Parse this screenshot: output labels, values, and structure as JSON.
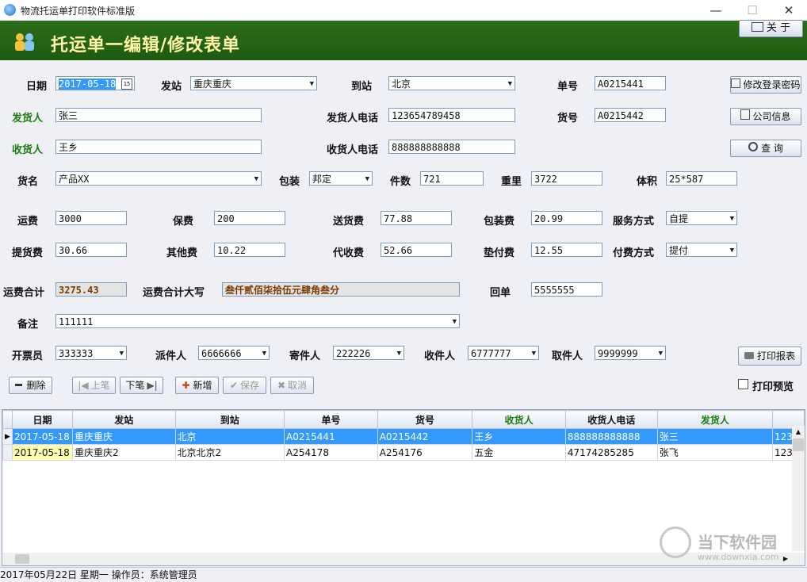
{
  "window": {
    "title": "物流托运单打印软件标准版",
    "min": "—",
    "max": "☐",
    "close": "✕"
  },
  "header": {
    "title": "托运单一编辑/修改表单",
    "about": "关 于"
  },
  "side_buttons": {
    "change_password": "修改登录密码",
    "company_info": "公司信息",
    "query": "查 询",
    "print_report": "打印报表"
  },
  "form": {
    "date_label": "日期",
    "date_value": "2017-05-18",
    "from_station_label": "发站",
    "from_station_value": "重庆重庆",
    "to_station_label": "到站",
    "to_station_value": "北京",
    "order_no_label": "单号",
    "order_no_value": "A0215441",
    "shipper_label": "发货人",
    "shipper_value": "张三",
    "shipper_phone_label": "发货人电话",
    "shipper_phone_value": "123654789458",
    "goods_no_label": "货号",
    "goods_no_value": "A0215442",
    "consignee_label": "收货人",
    "consignee_value": "王乡",
    "consignee_phone_label": "收货人电话",
    "consignee_phone_value": "888888888888",
    "goods_name_label": "货名",
    "goods_name_value": "产品XX",
    "packing_label": "包装",
    "packing_value": "邦定",
    "pieces_label": "件数",
    "pieces_value": "721",
    "weight_label": "重里",
    "weight_value": "3722",
    "volume_label": "体积",
    "volume_value": "25*587",
    "freight_label": "运费",
    "freight_value": "3000",
    "insurance_label": "保费",
    "insurance_value": "200",
    "delivery_fee_label": "送货费",
    "delivery_fee_value": "77.88",
    "packing_fee_label": "包装费",
    "packing_fee_value": "20.99",
    "service_label": "服务方式",
    "service_value": "自提",
    "pickup_fee_label": "提货费",
    "pickup_fee_value": "30.66",
    "other_fee_label": "其他费",
    "other_fee_value": "10.22",
    "collect_fee_label": "代收费",
    "collect_fee_value": "52.66",
    "advance_fee_label": "垫付费",
    "advance_fee_value": "12.55",
    "payment_label": "付费方式",
    "payment_value": "提付",
    "total_label": "运费合计",
    "total_value": "3275.43",
    "total_upper_label": "运费合计大写",
    "total_upper_value": "叁仟贰佰柒拾伍元肆角叁分",
    "receipt_label": "回单",
    "receipt_value": "5555555",
    "remark_label": "备注",
    "remark_value": "111111",
    "issuer_label": "开票员",
    "issuer_value": "333333",
    "dispatcher_label": "派件人",
    "dispatcher_value": "6666666",
    "sender_label": "寄件人",
    "sender_value": "222226",
    "receiver_label": "收件人",
    "receiver_value": "6777777",
    "collector_label": "取件人",
    "collector_value": "9999999"
  },
  "actions": {
    "delete": "删除",
    "prev": "上笔",
    "next": "下笔",
    "add": "新增",
    "save": "保存",
    "cancel": "取消",
    "print_preview": "打印预览"
  },
  "grid": {
    "columns": [
      "日期",
      "发站",
      "到站",
      "单号",
      "货号",
      "收货人",
      "收货人电话",
      "发货人",
      ""
    ],
    "rows": [
      [
        "2017-05-18",
        "重庆重庆",
        "北京",
        "A0215441",
        "A0215442",
        "王乡",
        "888888888888",
        "张三",
        "123"
      ],
      [
        "2017-05-18",
        "重庆重庆2",
        "北京北京2",
        "A254178",
        "A254176",
        "五金",
        "47174285285",
        "张飞",
        "123"
      ]
    ]
  },
  "status": {
    "text": "2017年05月22日   星期一  操作员：系统管理员"
  },
  "watermark": {
    "brand": "当下软件园",
    "url": "www.downxia.com"
  }
}
